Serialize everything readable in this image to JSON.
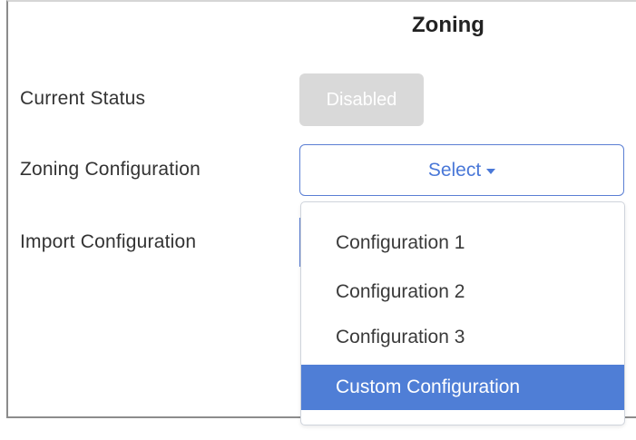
{
  "heading": "Zoning",
  "rows": {
    "current_status": "Current Status",
    "zoning_configuration": "Zoning Configuration",
    "import_configuration": "Import Configuration"
  },
  "status_badge": "Disabled",
  "select_button": {
    "label": "Select",
    "icon": "caret-down-icon"
  },
  "dropdown": {
    "items": [
      {
        "label": "Configuration 1",
        "selected": false
      },
      {
        "label": "Configuration 2",
        "selected": false
      },
      {
        "label": "Configuration 3",
        "selected": false
      },
      {
        "label": "Custom Configuration",
        "selected": true
      }
    ]
  },
  "colors": {
    "accent": "#4f7ed6",
    "badge_disabled": "#d9d9d9"
  }
}
